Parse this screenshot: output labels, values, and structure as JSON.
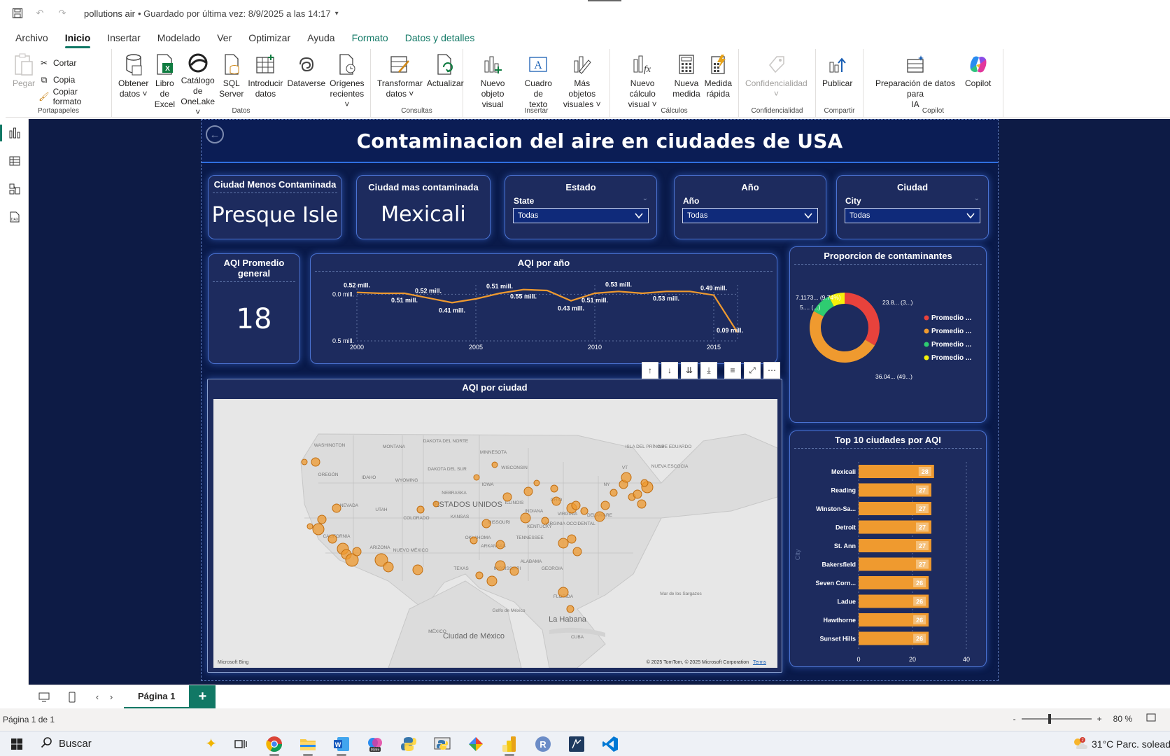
{
  "titlebar": {
    "doc_title": "pollutions air",
    "saved": "•  Guardado por última vez: 8/9/2025 a las 14:17"
  },
  "menu": {
    "tabs": [
      {
        "label": "Archivo",
        "style": "normal"
      },
      {
        "label": "Inicio",
        "style": "active"
      },
      {
        "label": "Insertar",
        "style": "normal"
      },
      {
        "label": "Modelado",
        "style": "normal"
      },
      {
        "label": "Ver",
        "style": "normal"
      },
      {
        "label": "Optimizar",
        "style": "normal"
      },
      {
        "label": "Ayuda",
        "style": "normal"
      },
      {
        "label": "Formato",
        "style": "green"
      },
      {
        "label": "Datos y detalles",
        "style": "green"
      }
    ]
  },
  "ribbon": {
    "portapapeles": {
      "name": "Portapapeles",
      "pegar": "Pegar",
      "cortar": "Cortar",
      "copia": "Copia",
      "copiar_formato": "Copiar formato"
    },
    "datos": {
      "name": "Datos",
      "obtener_1": "Obtener",
      "obtener_2": "datos ˅",
      "excel_1": "Libro de",
      "excel_2": "Excel",
      "onelake_1": "Catálogo de",
      "onelake_2": "OneLake ˅",
      "sql_1": "SQL",
      "sql_2": "Server",
      "introducir_1": "Introducir",
      "introducir_2": "datos",
      "dataverse": "Dataverse",
      "origenes_1": "Orígenes",
      "origenes_2": "recientes ˅"
    },
    "consultas": {
      "name": "Consultas",
      "transformar_1": "Transformar",
      "transformar_2": "datos ˅",
      "actualizar": "Actualizar"
    },
    "insertar": {
      "name": "Insertar",
      "nuevo_visual_1": "Nuevo objeto",
      "nuevo_visual_2": "visual",
      "cuadro_texto_1": "Cuadro de",
      "cuadro_texto_2": "texto",
      "mas_visuales_1": "Más objetos",
      "mas_visuales_2": "visuales ˅"
    },
    "calculos": {
      "name": "Cálculos",
      "nuevo_calculo_1": "Nuevo cálculo",
      "nuevo_calculo_2": "visual ˅",
      "nueva_medida_1": "Nueva",
      "nueva_medida_2": "medida",
      "medida_rapida_1": "Medida",
      "medida_rapida_2": "rápida"
    },
    "confidencialidad": {
      "name": "Confidencialidad",
      "btn": "Confidencialidad"
    },
    "compartir": {
      "name": "Compartir",
      "publicar": "Publicar"
    },
    "copilot": {
      "name": "Copilot",
      "prep_1": "Preparación de datos para",
      "prep_2": "IA",
      "copilot": "Copilot"
    }
  },
  "report": {
    "title": "Contaminacion del aire en ciudades de USA",
    "kpi_min": {
      "header": "Ciudad Menos Contaminada",
      "value": "Presque Isle"
    },
    "kpi_max": {
      "header": "Ciudad mas contaminada",
      "value": "Mexicali"
    },
    "slicer_estado": {
      "header": "Estado",
      "field": "State",
      "value": "Todas"
    },
    "slicer_ano": {
      "header": "Año",
      "field": "Año",
      "value": "Todas"
    },
    "slicer_ciudad": {
      "header": "Ciudad",
      "field": "City",
      "value": "Todas"
    },
    "kpi_aqi": {
      "header_1": "AQI Promedio",
      "header_2": "general",
      "value": "18"
    },
    "map": {
      "title": "AQI por ciudad",
      "attribution": "© 2025 TomTom, © 2025 Microsoft Corporation",
      "terms": "Terms",
      "bing": "Microsoft Bing"
    }
  },
  "line_chart": {
    "title": "AQI por año",
    "y_ticks": [
      "0.5 mill.",
      "0.0 mill."
    ],
    "x_ticks": [
      "2000",
      "2005",
      "2010",
      "2015"
    ],
    "labels": [
      "0.52 mill.",
      "0.51 mill.",
      "0.52 mill.",
      "0.41 mill.",
      "0.51 mill.",
      "0.55 mill.",
      "0.43 mill.",
      "0.51 mill.",
      "0.53 mill.",
      "0.53 mill.",
      "0.49 mill.",
      "0.09 mill."
    ]
  },
  "donut_chart": {
    "title": "Proporcion de contaminantes",
    "labels": [
      "23.8... (3...)",
      "36.04... (49...)",
      "7.1173... (9.74%)",
      "5.... (...)"
    ],
    "legend": [
      "Promedio ...",
      "Promedio ...",
      "Promedio ...",
      "Promedio ..."
    ]
  },
  "bar_chart": {
    "title": "Top 10 ciudades por AQI",
    "y_axis_title": "City",
    "x_ticks": [
      "0",
      "20",
      "40"
    ]
  },
  "chart_data": [
    {
      "type": "line",
      "title": "AQI por año",
      "x": [
        2000,
        2001,
        2002,
        2003,
        2004,
        2005,
        2006,
        2007,
        2008,
        2009,
        2010,
        2011,
        2012,
        2013,
        2014,
        2015,
        2016
      ],
      "series": [
        {
          "values": [
            0.52,
            0.51,
            0.51,
            0.46,
            0.41,
            0.45,
            0.51,
            0.55,
            0.54,
            0.43,
            0.51,
            0.53,
            0.51,
            0.53,
            0.53,
            0.49,
            0.09
          ]
        }
      ],
      "ylim": [
        0,
        0.6
      ],
      "y_ticks": [
        0,
        0.5
      ],
      "x_ticks": [
        2000,
        2005,
        2010,
        2015
      ],
      "grid": true
    },
    {
      "type": "pie",
      "title": "Proporcion de contaminantes",
      "donut": true,
      "categories": [
        "Promedio ...",
        "Promedio ...",
        "Promedio ...",
        "Promedio ..."
      ],
      "values": [
        33.5,
        49.3,
        9.74,
        7.46
      ],
      "colors": [
        "#e8423c",
        "#ef9a2f",
        "#2ecc71",
        "#f5f10a"
      ],
      "legend": "right"
    },
    {
      "type": "bar",
      "orientation": "horizontal",
      "title": "Top 10 ciudades por AQI",
      "categories": [
        "Mexicali",
        "Reading",
        "Winston-Sa...",
        "Detroit",
        "St. Ann",
        "Bakersfield",
        "Seven Corn...",
        "Ladue",
        "Hawthorne",
        "Sunset Hills"
      ],
      "values": [
        28,
        27,
        27,
        27,
        27,
        27,
        26,
        26,
        26,
        26
      ],
      "xlim": [
        0,
        40
      ],
      "ylabel": "City",
      "color": "#ef9a2f"
    }
  ],
  "map_labels": [
    {
      "text": "WASHINGTON",
      "big": false
    },
    {
      "text": "MONTANA",
      "big": false
    },
    {
      "text": "DAKOTA DEL NORTE",
      "big": false
    },
    {
      "text": "MINNESOTA",
      "big": false
    },
    {
      "text": "OREGÓN",
      "big": false
    },
    {
      "text": "IDAHO",
      "big": false
    },
    {
      "text": "WYOMING",
      "big": false
    },
    {
      "text": "DAKOTA DEL SUR",
      "big": false
    },
    {
      "text": "WISCONSIN",
      "big": false
    },
    {
      "text": "NEBRASKA",
      "big": false
    },
    {
      "text": "IOWA",
      "big": false
    },
    {
      "text": "NEVADA",
      "big": false
    },
    {
      "text": "UTAH",
      "big": false
    },
    {
      "text": "ESTADOS UNIDOS",
      "big": true
    },
    {
      "text": "ILLINOIS",
      "big": false
    },
    {
      "text": "INDIANA",
      "big": false
    },
    {
      "text": "OHIO",
      "big": false
    },
    {
      "text": "COLORADO",
      "big": false
    },
    {
      "text": "KANSAS",
      "big": false
    },
    {
      "text": "MISSOURI",
      "big": false
    },
    {
      "text": "KENTUCKY",
      "big": false
    },
    {
      "text": "VIRGINIA",
      "big": false
    },
    {
      "text": "CALIFORNIA",
      "big": false
    },
    {
      "text": "OKLAHOMA",
      "big": false
    },
    {
      "text": "ARKANSAS",
      "big": false
    },
    {
      "text": "TENNESSEE",
      "big": false
    },
    {
      "text": "ARIZONA",
      "big": false
    },
    {
      "text": "NUEVO MÉXICO",
      "big": false
    },
    {
      "text": "TEXAS",
      "big": false
    },
    {
      "text": "ALABAMA",
      "big": false
    },
    {
      "text": "MISSISSIPPI",
      "big": false
    },
    {
      "text": "GEORGIA",
      "big": false
    },
    {
      "text": "FLORIDA",
      "big": false
    },
    {
      "text": "Golfo de México",
      "big": false
    },
    {
      "text": "La Habana",
      "big": true
    },
    {
      "text": "MÉXICO",
      "big": false
    },
    {
      "text": "Ciudad de México",
      "big": true
    },
    {
      "text": "CUBA",
      "big": false
    },
    {
      "text": "Mar de los Sargazos",
      "big": false
    },
    {
      "text": "NUEVA ESCOCIA",
      "big": false
    },
    {
      "text": "NY",
      "big": false
    },
    {
      "text": "VT",
      "big": false
    },
    {
      "text": "NB",
      "big": false
    },
    {
      "text": "ISLA DEL PRÍNCIPE EDUARDO",
      "big": false
    },
    {
      "text": "DELAWARE",
      "big": false
    },
    {
      "text": "VIRGINIA OCCIDENTAL",
      "big": false
    }
  ],
  "pagebar": {
    "page_tab": "Página 1",
    "add": "+"
  },
  "statusbar": {
    "page_info": "Página 1 de 1",
    "zoom": "80 %",
    "minus": "-",
    "plus": "+"
  },
  "taskbar": {
    "search": "Buscar",
    "weather": "31°C  Parc. soleado"
  }
}
